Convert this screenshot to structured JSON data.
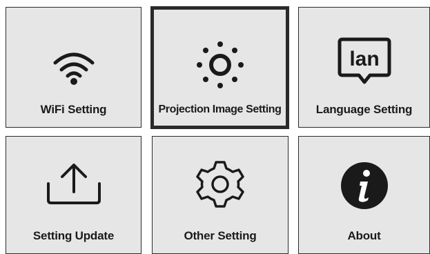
{
  "menu": {
    "items": [
      {
        "label": "WiFi Setting",
        "icon": "wifi-icon"
      },
      {
        "label": "Projection Image Setting",
        "icon": "brightness-icon",
        "selected": true
      },
      {
        "label": "Language Setting",
        "icon": "language-icon",
        "icon_text": "lan"
      },
      {
        "label": "Setting Update",
        "icon": "upload-icon"
      },
      {
        "label": "Other Setting",
        "icon": "gear-icon"
      },
      {
        "label": "About",
        "icon": "info-icon"
      }
    ]
  },
  "colors": {
    "tile_bg": "#e6e6e6",
    "border": "#2a2a2a",
    "icon": "#1a1a1a"
  }
}
